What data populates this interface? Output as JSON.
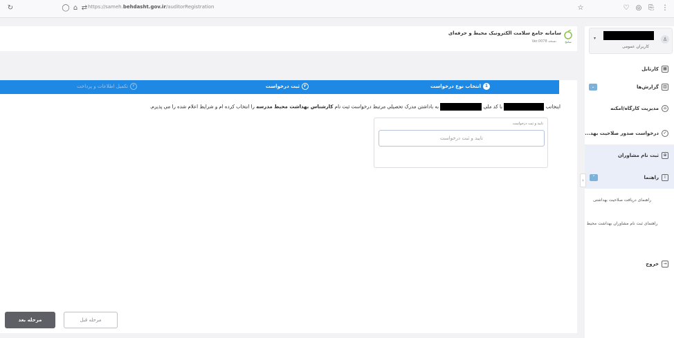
{
  "browser": {
    "url_prefix": "https://sameh.",
    "url_domain": "behdasht.gov.ir",
    "url_path": "/auditorRegistration"
  },
  "header": {
    "app_name": "سامانه جامع سلامت الکترونیک محیط و حرفه‌ای",
    "app_sub": "Ver.0078 نسخه",
    "logo_text": "سامح"
  },
  "user": {
    "role": "کاربران عمومی"
  },
  "sidebar": {
    "items": [
      {
        "label": "کارتابل",
        "icon": "dashboard-icon"
      },
      {
        "label": "گزارش‌ها",
        "icon": "report-icon",
        "badge": "⌄"
      },
      {
        "label": "مدیریت کارگاه/امکنه",
        "icon": "workshop-icon"
      },
      {
        "label": "درخواست صدور صلاحیت بهد...",
        "icon": "certificate-icon"
      },
      {
        "label": "ثبت نام مشاوران",
        "icon": "register-icon"
      },
      {
        "label": "راهنما",
        "icon": "help-icon",
        "badge": "⌃"
      }
    ],
    "sub_items": [
      "راهنمای دریافت صلاحیت بهداشتی",
      "راهنمای ثبت نام مشاوران بهداشت محیط"
    ],
    "logout": "خروج"
  },
  "stepper": {
    "steps": [
      {
        "num": "1",
        "label": "انتخاب نوع درخواست",
        "state": "done"
      },
      {
        "num": "۲",
        "label": "ثبت درخواست",
        "state": "current"
      },
      {
        "num": "۳",
        "label": "تکمیل اطلاعات و پرداخت",
        "state": "inactive"
      }
    ]
  },
  "agreement": {
    "part1": "اینجانب",
    "part2": "با کد ملی",
    "part3": "به باداشتن مدرک تحصیلی مرتبط درخواست ثبت نام",
    "bold": "کارشناس بهداشت محیط مدرسه",
    "part4": "را انتخاب کرده ام و شرایط اعلام شده را می پذیرم."
  },
  "confirm": {
    "title": "تایید و ثبت درخواست",
    "button": "تایید و ثبت درخواست"
  },
  "nav": {
    "prev": "مرحله قبل",
    "next": "مرحله بعد"
  }
}
